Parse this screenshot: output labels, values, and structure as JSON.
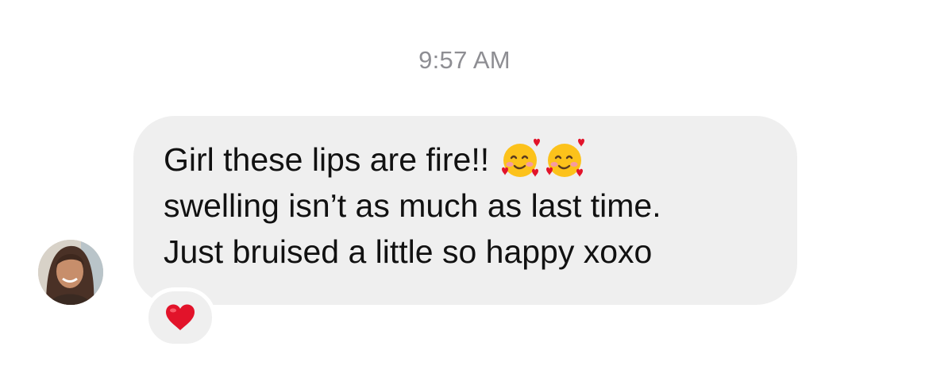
{
  "conversation": {
    "timestamp": "9:57 AM"
  },
  "message": {
    "sender_avatar_icon": "contact-photo",
    "lines": [
      "Girl these lips are fire!!",
      "swelling isn’t as much as last time.",
      "Just bruised a little so happy xoxo"
    ],
    "inline_emoji": [
      "smiling-face-with-hearts-icon",
      "smiling-face-with-hearts-icon"
    ],
    "bubble_color": "#efefef",
    "text_color": "#111111"
  },
  "reaction": {
    "icon": "red-heart-icon",
    "color": "#e2132a"
  }
}
